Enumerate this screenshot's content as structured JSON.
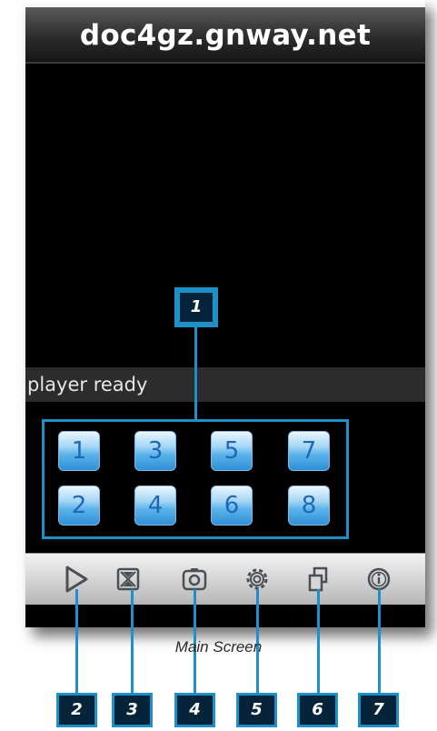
{
  "app": {
    "host_title": "doc4gz.gnway.net"
  },
  "status": {
    "message": "player ready"
  },
  "channels": {
    "top_row": [
      "1",
      "3",
      "5",
      "7"
    ],
    "bottom_row": [
      "2",
      "4",
      "6",
      "8"
    ]
  },
  "toolbar": {
    "items": [
      {
        "name": "play",
        "icon": "play-icon"
      },
      {
        "name": "stop",
        "icon": "stop-icon"
      },
      {
        "name": "snapshot",
        "icon": "camera-icon"
      },
      {
        "name": "settings",
        "icon": "gear-icon"
      },
      {
        "name": "switch-view",
        "icon": "multi-view-icon"
      },
      {
        "name": "info",
        "icon": "info-icon"
      }
    ]
  },
  "callouts": {
    "channel_panel": "1",
    "bottom": [
      "2",
      "3",
      "4",
      "5",
      "6",
      "7"
    ]
  },
  "caption": "Main Screen",
  "colors": {
    "accent": "#1d90c7",
    "callout_fill": "#05243a",
    "channel_text": "#1f68b8"
  }
}
